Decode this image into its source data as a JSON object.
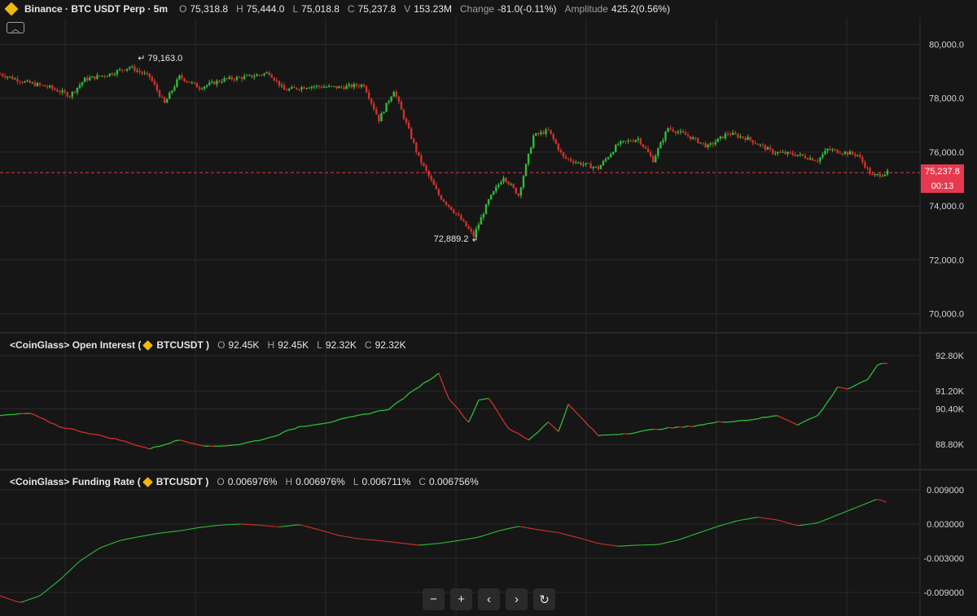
{
  "header": {
    "symbol": "Binance · BTC USDT Perp · 5m",
    "open_label": "O",
    "open": "75,318.8",
    "high_label": "H",
    "high": "75,444.0",
    "low_label": "L",
    "low": "75,018.8",
    "close_label": "C",
    "close": "75,237.8",
    "volume_label": "V",
    "volume": "153.23M",
    "change_label": "Change",
    "change": "-81.0(-0.11%)",
    "amplitude_label": "Amplitude",
    "amplitude": "425.2(0.56%)"
  },
  "collapse_icon": "chevron-up-icon",
  "price_tag": {
    "price": "75,237.8",
    "countdown": "00:13"
  },
  "annotations": {
    "high": "79,163.0",
    "low": "72,889.2"
  },
  "oi_header": {
    "name": "<CoinGlass> Open Interest (",
    "symbol": "BTCUSDT )",
    "o_label": "O",
    "o": "92.45K",
    "h_label": "H",
    "h": "92.45K",
    "l_label": "L",
    "l": "92.32K",
    "c_label": "C",
    "c": "92.32K"
  },
  "fr_header": {
    "name": "<CoinGlass> Funding Rate (",
    "symbol": "BTCUSDT )",
    "o_label": "O",
    "o": "0.006976%",
    "h_label": "H",
    "h": "0.006976%",
    "l_label": "L",
    "l": "0.006711%",
    "c_label": "C",
    "c": "0.006756%"
  },
  "zoom_controls": [
    "−",
    "+",
    "‹",
    "›",
    "↻"
  ],
  "colors": {
    "up": "#2ebd39",
    "down": "#d1312b",
    "last_price": "#e8384f",
    "grid": "#2a2a2a"
  },
  "chart_data": [
    {
      "type": "candlestick",
      "title": "Binance · BTC USDT Perp · 5m",
      "ylim": [
        69500,
        80500
      ],
      "y_ticks": [
        "80,000.0",
        "78,000.0",
        "76,000.0",
        "74,000.0",
        "72,000.0",
        "70,000.0"
      ],
      "high_marker": 79163.0,
      "low_marker": 72889.2,
      "last_price": 75237.8,
      "path": [
        [
          0,
          78900
        ],
        [
          5,
          78600
        ],
        [
          10,
          78400
        ],
        [
          14,
          78100
        ],
        [
          17,
          78700
        ],
        [
          22,
          78900
        ],
        [
          26,
          79163
        ],
        [
          30,
          78800
        ],
        [
          33,
          77800
        ],
        [
          36,
          78800
        ],
        [
          40,
          78400
        ],
        [
          45,
          78700
        ],
        [
          50,
          78800
        ],
        [
          54,
          78950
        ],
        [
          57,
          78300
        ],
        [
          62,
          78450
        ],
        [
          68,
          78400
        ],
        [
          73,
          78500
        ],
        [
          76,
          77200
        ],
        [
          79,
          78300
        ],
        [
          84,
          75800
        ],
        [
          88,
          74400
        ],
        [
          92,
          73600
        ],
        [
          95,
          72889
        ],
        [
          98,
          74200
        ],
        [
          101,
          75100
        ],
        [
          104,
          74400
        ],
        [
          107,
          76600
        ],
        [
          110,
          76800
        ],
        [
          113,
          75800
        ],
        [
          116,
          75600
        ],
        [
          120,
          75400
        ],
        [
          124,
          76300
        ],
        [
          128,
          76500
        ],
        [
          131,
          75700
        ],
        [
          134,
          76900
        ],
        [
          138,
          76600
        ],
        [
          142,
          76200
        ],
        [
          146,
          76700
        ],
        [
          150,
          76500
        ],
        [
          155,
          76000
        ],
        [
          160,
          75900
        ],
        [
          164,
          75700
        ],
        [
          166,
          76100
        ],
        [
          172,
          75900
        ],
        [
          175,
          75100
        ],
        [
          178,
          75238
        ]
      ]
    },
    {
      "type": "line",
      "title": "<CoinGlass> Open Interest",
      "ylim": [
        88000,
        93500
      ],
      "y_ticks": [
        "92.80K",
        "91.20K",
        "90.40K",
        "88.80K"
      ],
      "x": [
        0,
        6,
        12,
        18,
        24,
        30,
        36,
        42,
        48,
        54,
        60,
        66,
        72,
        78,
        84,
        88,
        90,
        94,
        96,
        98,
        100,
        102,
        104,
        106,
        108,
        110,
        112,
        114,
        120,
        126,
        132,
        138,
        144,
        150,
        156,
        160,
        164,
        166,
        168,
        170,
        174,
        176,
        178
      ],
      "values": [
        90.1,
        90.2,
        89.6,
        89.3,
        89.0,
        88.6,
        89.0,
        88.7,
        88.8,
        89.1,
        89.6,
        89.8,
        90.1,
        90.4,
        91.4,
        92.0,
        90.9,
        89.8,
        90.8,
        90.9,
        90.2,
        89.5,
        89.3,
        89.0,
        89.4,
        89.8,
        89.4,
        90.6,
        89.2,
        89.3,
        89.5,
        89.6,
        89.8,
        89.9,
        90.1,
        89.7,
        90.1,
        90.7,
        91.4,
        91.3,
        91.7,
        92.4,
        92.45
      ]
    },
    {
      "type": "line",
      "title": "<CoinGlass> Funding Rate",
      "ylim": [
        -0.011,
        0.011
      ],
      "y_ticks": [
        "0.009000",
        "0.003000",
        "-0.003000",
        "-0.009000"
      ],
      "x": [
        0,
        4,
        8,
        12,
        16,
        20,
        24,
        28,
        32,
        36,
        40,
        44,
        48,
        52,
        56,
        60,
        64,
        68,
        72,
        76,
        80,
        84,
        88,
        92,
        96,
        100,
        104,
        108,
        112,
        116,
        120,
        124,
        128,
        132,
        136,
        140,
        144,
        148,
        152,
        156,
        160,
        164,
        168,
        172,
        176,
        178
      ],
      "values": [
        -0.0096,
        -0.0108,
        -0.0096,
        -0.0068,
        -0.0035,
        -0.0012,
        0.0001,
        0.0008,
        0.0014,
        0.0018,
        0.0024,
        0.0028,
        0.003,
        0.0028,
        0.0025,
        0.0029,
        0.002,
        0.001,
        0.0004,
        0.0001,
        -0.0003,
        -0.0007,
        -0.0004,
        0.0001,
        0.0007,
        0.0018,
        0.0026,
        0.002,
        0.0015,
        0.0006,
        -0.0004,
        -0.0009,
        -0.0007,
        -0.0006,
        0.0002,
        0.0014,
        0.0026,
        0.0036,
        0.0042,
        0.0037,
        0.0027,
        0.0032,
        0.0046,
        0.006,
        0.0074,
        0.0068
      ]
    }
  ]
}
